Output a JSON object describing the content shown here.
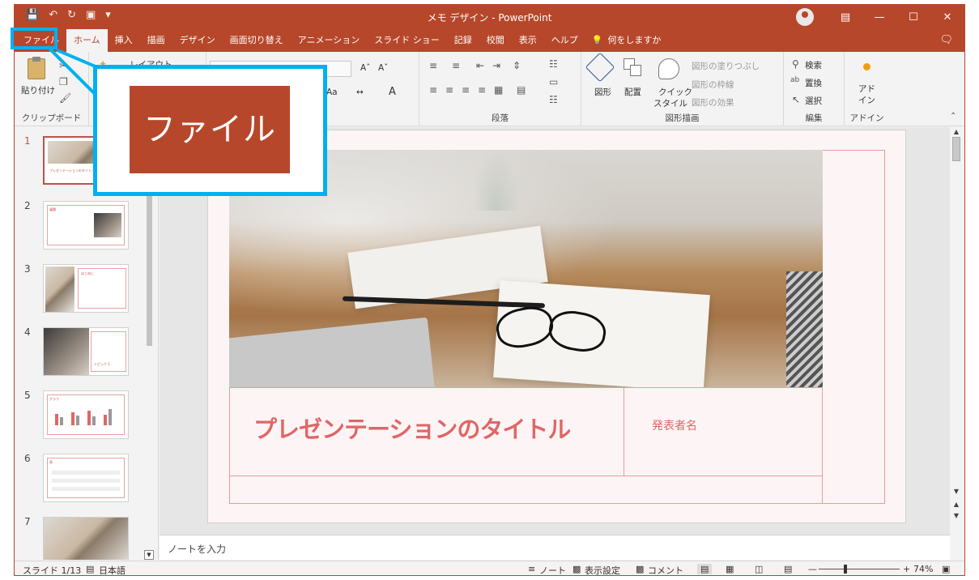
{
  "titlebar": {
    "save_icon": "save-icon",
    "undo_icon": "undo-icon",
    "redo_icon": "redo-icon",
    "title": "メモ デザイン  -  PowerPoint",
    "controls": [
      "ribbon-display-icon",
      "minimize-icon",
      "maximize-icon",
      "close-icon"
    ]
  },
  "tabs": [
    "ファイル",
    "ホーム",
    "挿入",
    "描画",
    "デザイン",
    "画面切り替え",
    "アニメーション",
    "スライド ショー",
    "記録",
    "校閲",
    "表示",
    "ヘルプ"
  ],
  "tell_me": "何をしますか",
  "ribbon": {
    "clipboard": {
      "paste": "貼り付け",
      "label": "クリップボード"
    },
    "slides": {
      "layout": "レイアウト"
    },
    "font": {
      "aa": "Aa"
    },
    "paragraph": {
      "label": "段落"
    },
    "drawing": {
      "shape": "図形",
      "arrange": "配置",
      "quick_style_1": "クイック",
      "quick_style_2": "スタイル",
      "fill": "図形の塗りつぶし",
      "outline": "図形の枠線",
      "effect": "図形の効果",
      "label": "図形描画"
    },
    "editing": {
      "find": "検索",
      "replace": "置換",
      "select": "選択",
      "label": "編集"
    },
    "addins": {
      "addin_1": "アド",
      "addin_2": "イン",
      "label": "アドイン"
    }
  },
  "thumbnails": {
    "numbers": [
      "1",
      "2",
      "3",
      "4",
      "5",
      "6",
      "7"
    ],
    "s1_title": "プレゼンテーションのタイトル",
    "s2_title": "議題",
    "s3_title": "はじめに",
    "s4_title": "トピック 1",
    "s5_title": "グラフ",
    "s6_title": "表"
  },
  "slide": {
    "title": "プレゼンテーションのタイトル",
    "presenter": "発表者名"
  },
  "notes_placeholder": "ノートを入力",
  "statusbar": {
    "slide_count": "スライド 1/13",
    "language": "日本語",
    "notes": "ノート",
    "display_settings": "表示設定",
    "comments": "コメント",
    "zoom": "74%",
    "zoom_level_fraction": 0.33
  },
  "callout": {
    "text": "ファイル"
  },
  "colors": {
    "brand": "#b7472a",
    "highlight": "#00b0f0",
    "accent": "#e06666"
  }
}
